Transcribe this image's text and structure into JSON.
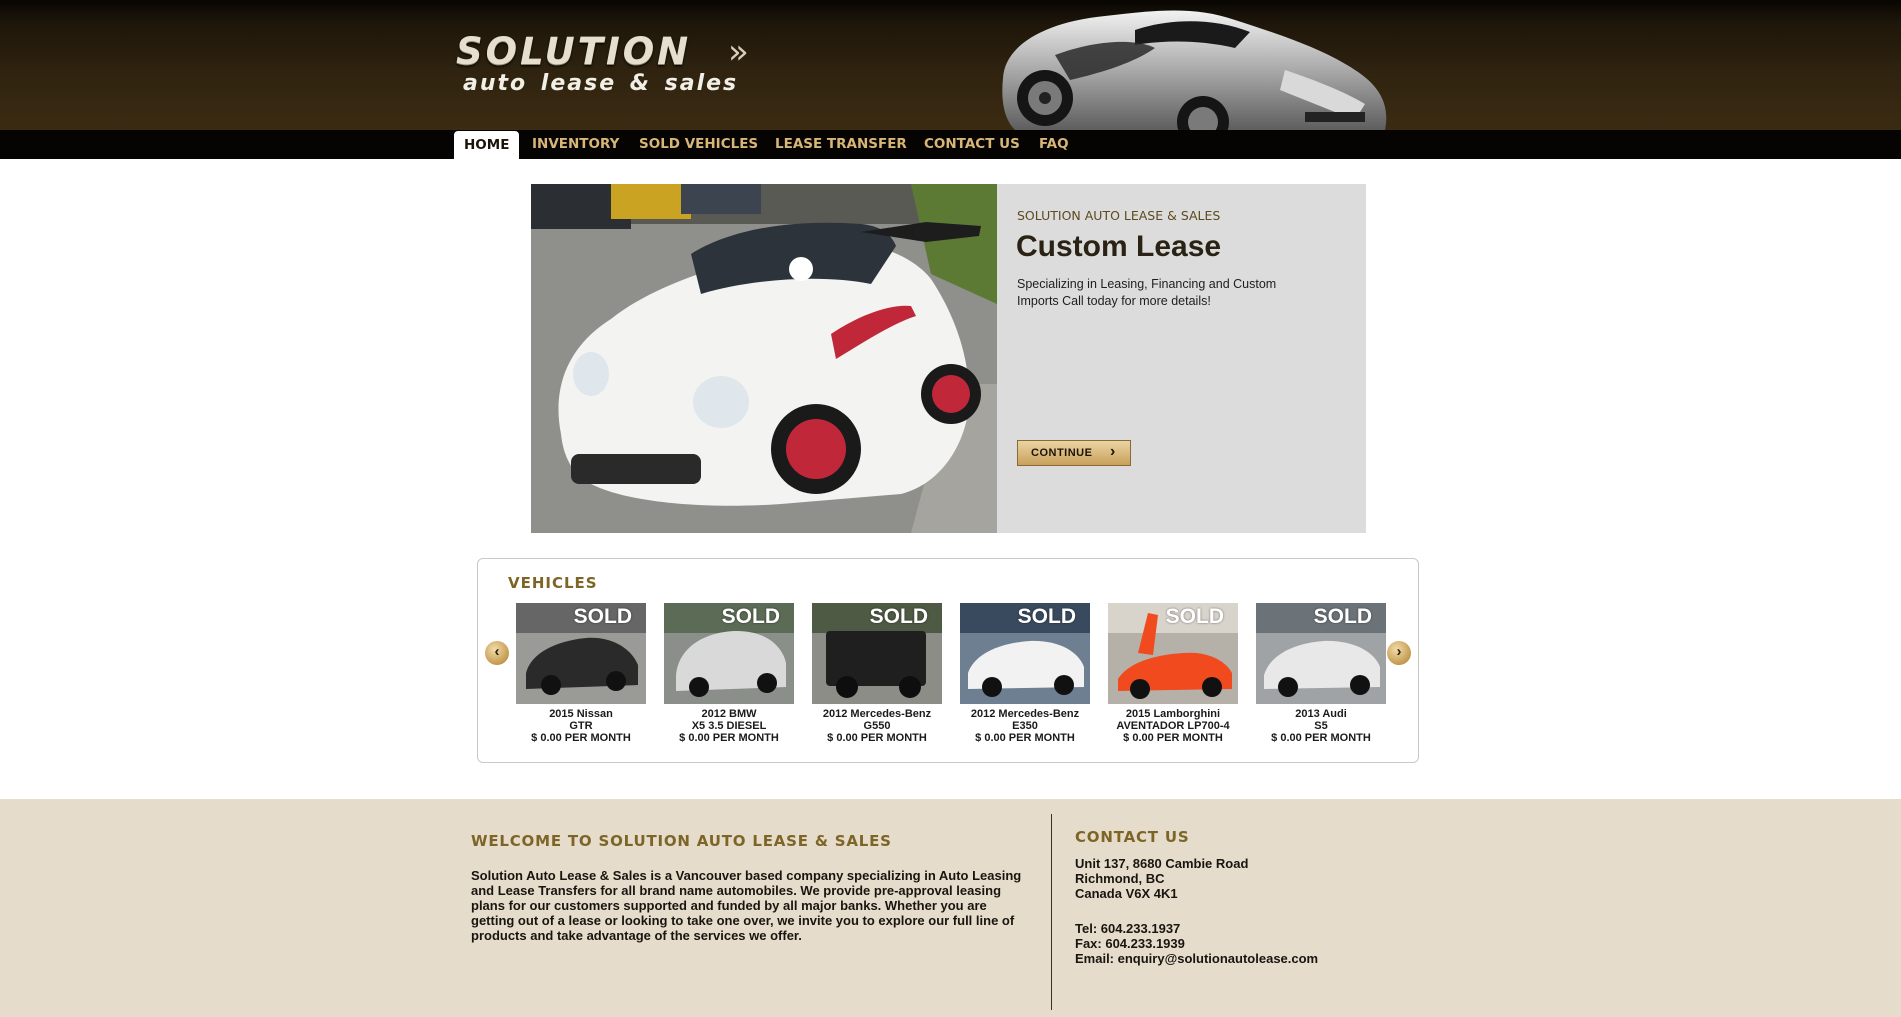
{
  "logo": {
    "main": "SOLUTION",
    "chevrons": "»",
    "sub": "auto lease & sales"
  },
  "nav": {
    "items": [
      "HOME",
      "INVENTORY",
      "SOLD VEHICLES",
      "LEASE TRANSFER",
      "CONTACT US",
      "FAQ"
    ],
    "active": "HOME"
  },
  "slide": {
    "kicker": "SOLUTION AUTO LEASE & SALES",
    "title": "Custom Lease",
    "text": "Specializing in Leasing, Financing and Custom Imports Call today for more details!",
    "button": "CONTINUE"
  },
  "vehicles": {
    "title": "VEHICLES",
    "prev_icon": "chevron-left-icon",
    "next_icon": "chevron-right-icon",
    "items": [
      {
        "sold": "SOLD",
        "name": "2015 Nissan",
        "model": "GTR",
        "price": "$ 0.00 PER MONTH",
        "color": "#2a2a2a"
      },
      {
        "sold": "SOLD",
        "name": "2012 BMW",
        "model": "X5 3.5 DIESEL",
        "price": "$ 0.00 PER MONTH",
        "color": "#d9d9d9"
      },
      {
        "sold": "SOLD",
        "name": "2012 Mercedes-Benz",
        "model": "G550",
        "price": "$ 0.00 PER MONTH",
        "color": "#1f1f1f"
      },
      {
        "sold": "SOLD",
        "name": "2012 Mercedes-Benz",
        "model": "E350",
        "price": "$ 0.00 PER MONTH",
        "color": "#f2f2f2"
      },
      {
        "sold": "SOLD",
        "name": "2015 Lamborghini",
        "model": "AVENTADOR LP700-4",
        "price": "$ 0.00 PER MONTH",
        "color": "#f04a1e"
      },
      {
        "sold": "SOLD",
        "name": "2013 Audi",
        "model": "S5",
        "price": "$ 0.00 PER MONTH",
        "color": "#e8e8e8"
      }
    ]
  },
  "footer": {
    "welcome_title": "WELCOME TO SOLUTION AUTO LEASE & SALES",
    "welcome_text": "Solution Auto Lease & Sales is a Vancouver based company specializing in Auto Leasing and Lease Transfers for all brand name automobiles. We provide pre-approval leasing plans for our customers supported and funded by all major banks. Whether you are getting out of a lease or looking to take one over, we invite you to explore our full line of products and take advantage of the services we offer.",
    "contact_title": "CONTACT US",
    "address_1": "Unit 137, 8680 Cambie Road",
    "address_2": "Richmond, BC",
    "address_3": "Canada V6X 4K1",
    "tel": "Tel: 604.233.1937",
    "fax": "Fax: 604.233.1939",
    "email": "Email: enquiry@solutionautolease.com"
  },
  "colors": {
    "header_brown": "#3b2b12",
    "nav_gold": "#d8b676",
    "heading_gold": "#7d6527",
    "footer_bg": "#e6dccb",
    "slide_bg": "#dcdcdc"
  }
}
